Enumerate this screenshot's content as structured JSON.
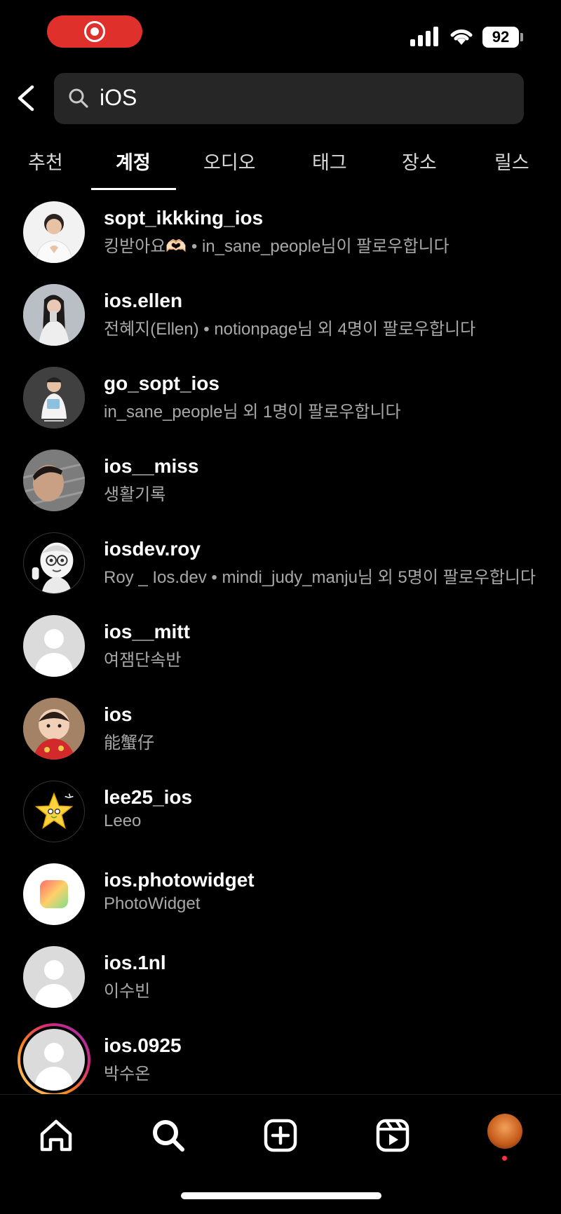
{
  "status": {
    "battery": "92"
  },
  "search": {
    "query": "iOS"
  },
  "tabs": [
    {
      "label": "추천"
    },
    {
      "label": "계정"
    },
    {
      "label": "오디오"
    },
    {
      "label": "태그"
    },
    {
      "label": "장소"
    },
    {
      "label": "릴스"
    }
  ],
  "active_tab": "계정",
  "results": [
    {
      "username": "sopt_ikkking_ios",
      "subtitle": "킹받아요🫶🏻 • in_sane_people님이 팔로우합니다",
      "avatar": "photo-person"
    },
    {
      "username": "ios.ellen",
      "subtitle": "전혜지(Ellen) • notionpage님 외 4명이 팔로우합니다",
      "avatar": "photo-person"
    },
    {
      "username": "go_sopt_ios",
      "subtitle": "in_sane_people님 외 1명이 팔로우합니다",
      "avatar": "photo-person"
    },
    {
      "username": "ios__miss",
      "subtitle": "생활기록",
      "avatar": "photo-person"
    },
    {
      "username": "iosdev.roy",
      "subtitle": "Roy _ Ios.dev • mindi_judy_manju님 외 5명이 팔로우합니다",
      "avatar": "memoji"
    },
    {
      "username": "ios__mitt",
      "subtitle": "여잼단속반",
      "avatar": "default"
    },
    {
      "username": "ios",
      "subtitle": "能蟹仔",
      "avatar": "photo-child"
    },
    {
      "username": "lee25_ios",
      "subtitle": "Leeo",
      "avatar": "star-emoji"
    },
    {
      "username": "ios.photowidget",
      "subtitle": "PhotoWidget",
      "avatar": "app-icon"
    },
    {
      "username": "ios.1nl",
      "subtitle": "이수빈",
      "avatar": "default"
    },
    {
      "username": "ios.0925",
      "subtitle": "박수온",
      "avatar": "default-story"
    }
  ],
  "nav": [
    {
      "icon": "home-icon"
    },
    {
      "icon": "search-icon"
    },
    {
      "icon": "create-icon"
    },
    {
      "icon": "reels-icon"
    },
    {
      "icon": "profile-avatar"
    }
  ]
}
